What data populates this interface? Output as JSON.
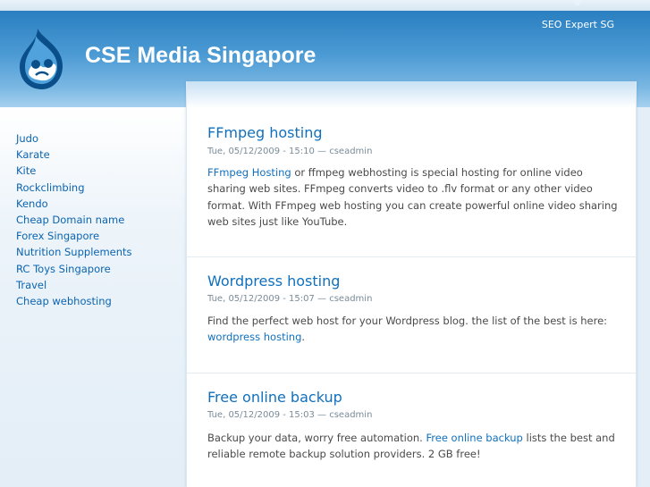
{
  "site": {
    "name": "CSE Media Singapore",
    "primary_link": "SEO Expert SG"
  },
  "sidebar": {
    "items": [
      "Judo",
      "Karate",
      "Kite",
      "Rockclimbing",
      "Kendo",
      "Cheap Domain name",
      "Forex Singapore",
      "Nutrition Supplements",
      "RC Toys Singapore",
      "Travel",
      "Cheap webhosting"
    ]
  },
  "posts": [
    {
      "title": "FFmpeg hosting",
      "submitted": "Tue, 05/12/2009 - 15:10 — cseadmin",
      "link_text": "FFmpeg Hosting",
      "body_after": " or ffmpeg webhosting is special hosting for online video sharing web sites. FFmpeg converts video to .flv format or any other video format. With FFmpeg web hosting you can create powerful online video sharing web sites just like YouTube."
    },
    {
      "title": "Wordpress hosting",
      "submitted": "Tue, 05/12/2009 - 15:07 — cseadmin",
      "body_before": "Find the perfect web host for your Wordpress blog. the list of the best is here: ",
      "link_text": "wordpress hosting",
      "body_after": "."
    },
    {
      "title": "Free online backup",
      "submitted": "Tue, 05/12/2009 - 15:03 — cseadmin",
      "body_before": "Backup your data, worry free automation. ",
      "link_text": "Free online backup",
      "body_after": " lists the best and reliable remote backup solution providers. 2 GB free!"
    }
  ],
  "colors": {
    "header_blue": "#2a7fc0",
    "link_blue": "#1170bd",
    "sidebar_link": "#0b64b0"
  }
}
